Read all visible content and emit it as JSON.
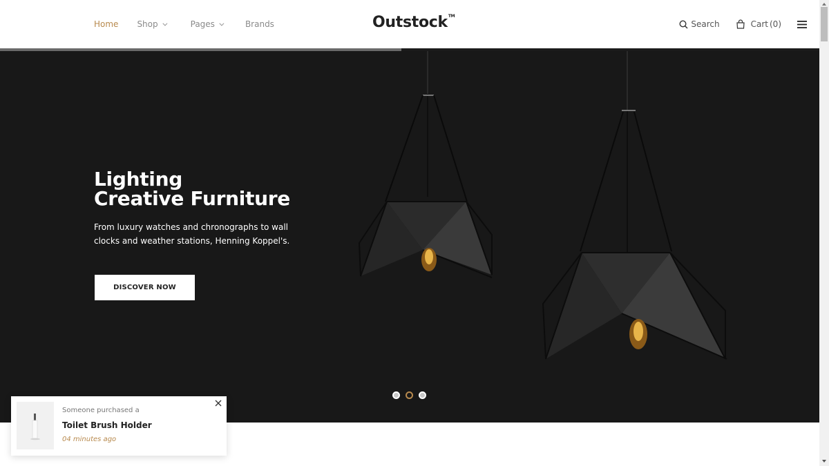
{
  "header": {
    "logo": "Outstock",
    "logo_mark": "TM",
    "nav": [
      {
        "label": "Home",
        "active": true,
        "has_dropdown": false
      },
      {
        "label": "Shop",
        "active": false,
        "has_dropdown": true
      },
      {
        "label": "Pages",
        "active": false,
        "has_dropdown": true
      },
      {
        "label": "Brands",
        "active": false,
        "has_dropdown": false
      }
    ],
    "search_label": "Search",
    "cart_label": "Cart",
    "cart_count": "(0)",
    "icons": {
      "search": "search-icon",
      "cart": "shopping-bag-icon",
      "menu": "hamburger-menu-icon"
    }
  },
  "slider": {
    "progress": 0.49,
    "title_line1": "Lighting",
    "title_line2": "Creative Furniture",
    "description": "From luxury watches and chronographs to wall clocks and weather stations, Henning Koppel's.",
    "button_label": "DISCOVER NOW",
    "slide_count": 3,
    "active_slide": 2
  },
  "notification": {
    "line1": "Someone purchased a",
    "product": "Toilet Brush Holder",
    "time": "04 minutes ago"
  },
  "colors": {
    "accent": "#b88a4e",
    "hero_bg": "#181818",
    "text_dark": "#222222",
    "nav_text": "#8a8a8a"
  }
}
